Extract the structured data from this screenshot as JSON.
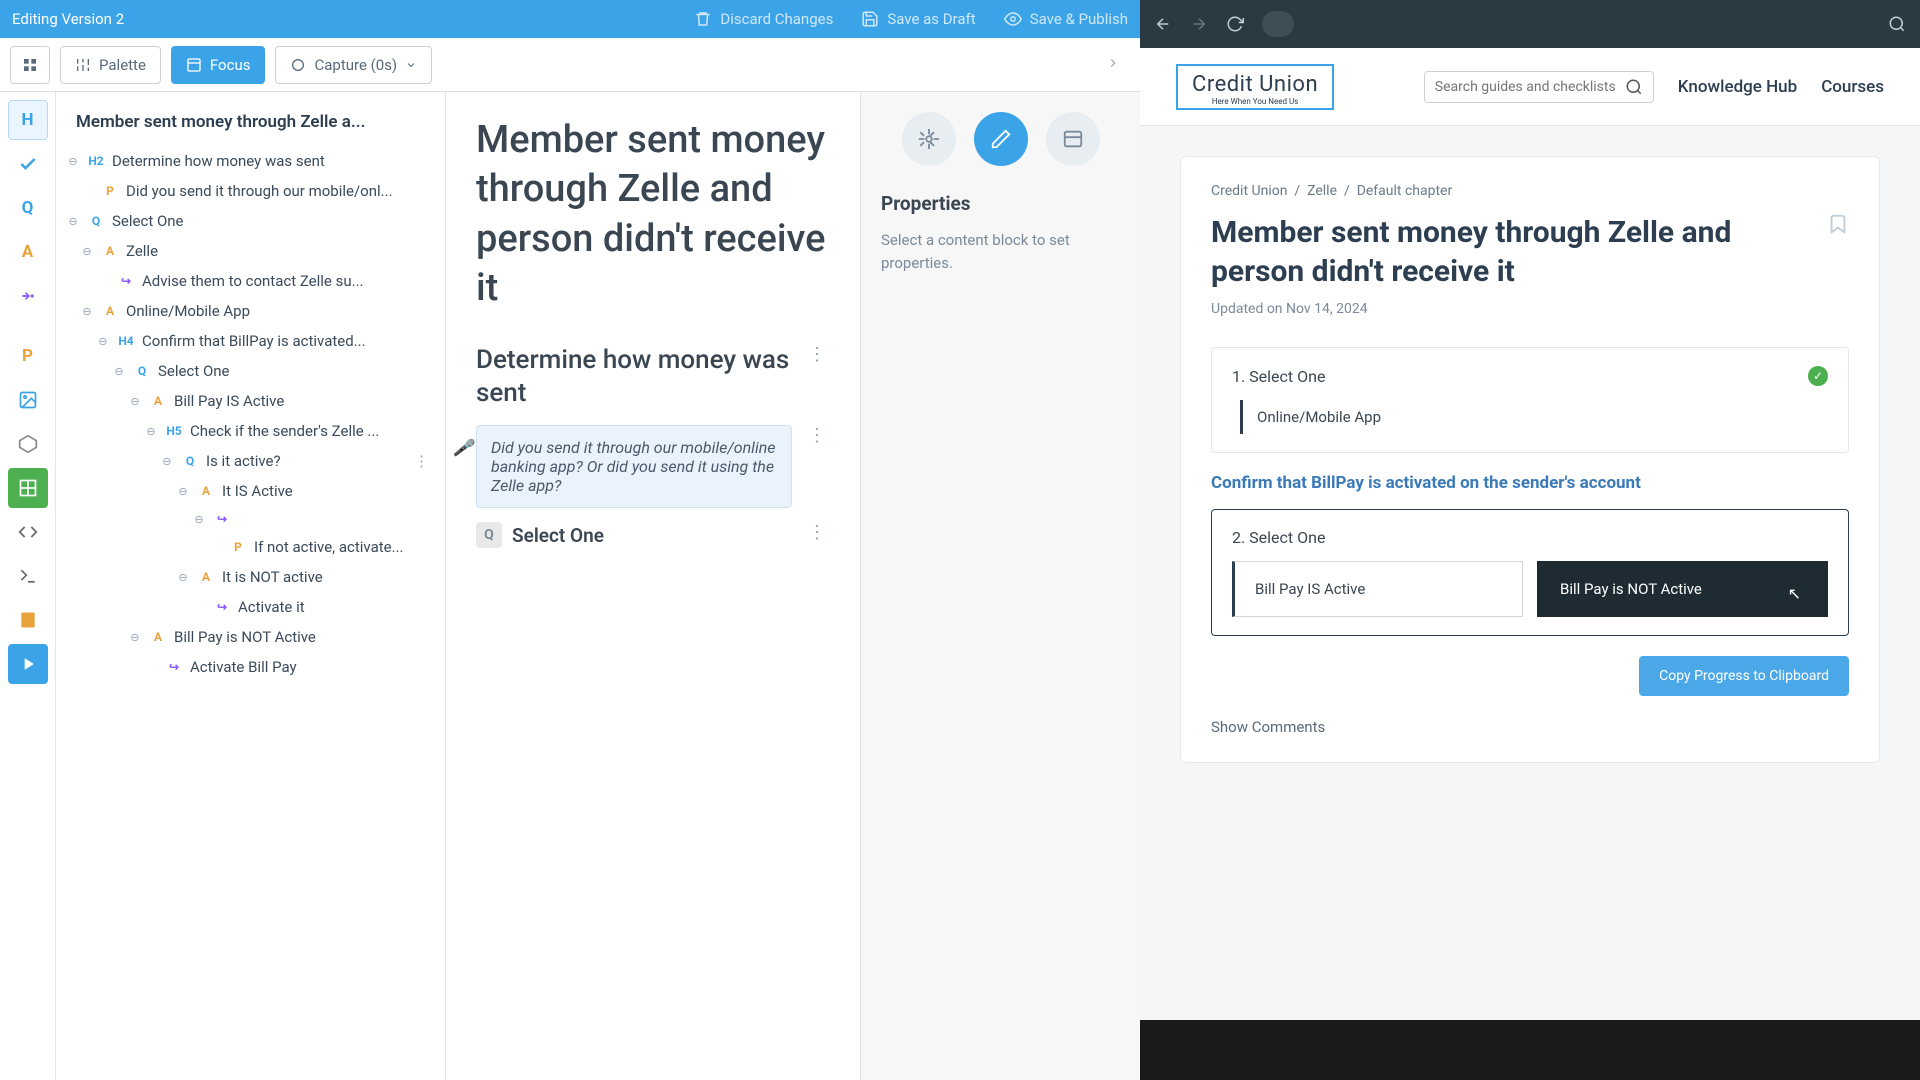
{
  "topBar": {
    "title": "Editing Version 2",
    "discard": "Discard Changes",
    "saveDraft": "Save as Draft",
    "savePublish": "Save & Publish"
  },
  "toolbar": {
    "palette": "Palette",
    "focus": "Focus",
    "capture": "Capture (0s)"
  },
  "tree": {
    "title": "Member sent money through Zelle a...",
    "n1": "Determine how money was sent",
    "n2": "Did you send it through our mobile/onl...",
    "n3": "Select One",
    "n4": "Zelle",
    "n5": "Advise them to contact Zelle su...",
    "n6": "Online/Mobile App",
    "n7": "Confirm that BillPay is activated...",
    "n8": "Select One",
    "n9": "Bill Pay IS Active",
    "n10": "Check if the sender's Zelle ...",
    "n11": "Is it active?",
    "n12": "It IS Active",
    "n13": "If not active, activate...",
    "n14": "It is NOT active",
    "n15": "Activate it",
    "n16": "Bill Pay is NOT Active",
    "n17": "Activate Bill Pay"
  },
  "editor": {
    "h1": "Member sent money through Zelle and person didn't receive it",
    "h2": "Determine how money was sent",
    "prompt": "Did you send it through our mobile/online banking app? Or did you send it using the Zelle app?",
    "select": "Select One"
  },
  "props": {
    "title": "Properties",
    "desc": "Select a content block to set properties."
  },
  "site": {
    "logoBig": "Credit Union",
    "logoSmall": "Here When You Need Us",
    "searchPlaceholder": "Search guides and checklists",
    "navKnowledge": "Knowledge Hub",
    "navCourses": "Courses"
  },
  "page": {
    "crumb1": "Credit Union",
    "crumb2": "Zelle",
    "crumb3": "Default chapter",
    "title": "Member sent money through Zelle and person didn't receive it",
    "updated": "Updated on Nov 14, 2024",
    "step1": "1. Select One",
    "step1choice": "Online/Mobile App",
    "sectionH": "Confirm that BillPay is activated on the sender's account",
    "step2": "2. Select One",
    "opt1": "Bill Pay IS Active",
    "opt2": "Bill Pay is NOT Active",
    "copy": "Copy Progress to Clipboard",
    "comments": "Show Comments"
  }
}
